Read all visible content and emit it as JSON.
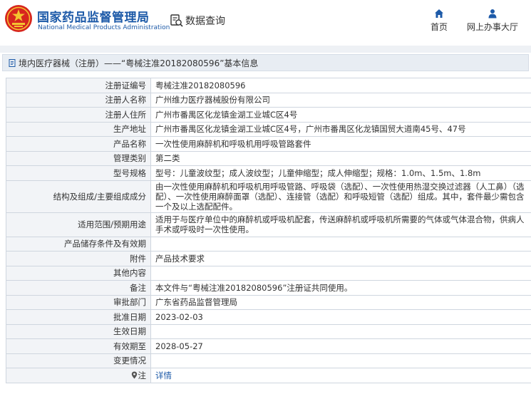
{
  "header": {
    "org_name_cn": "国家药品监督管理局",
    "org_name_en": "National Medical Products Administration",
    "query_label": "数据查询",
    "nav": [
      {
        "label": "首页",
        "icon": "home-icon"
      },
      {
        "label": "网上办事大厅",
        "icon": "user-icon"
      }
    ]
  },
  "title_bar": {
    "text": "境内医疗器械（注册）——“粤械注准20182080596”基本信息"
  },
  "rows": [
    {
      "label": "注册证编号",
      "value": "粤械注准20182080596"
    },
    {
      "label": "注册人名称",
      "value": "广州维力医疗器械股份有限公司"
    },
    {
      "label": "注册人住所",
      "value": "广州市番禺区化龙镇金湖工业城C区4号"
    },
    {
      "label": "生产地址",
      "value": "广州市番禺区化龙镇金湖工业城C区4号，广州市番禺区化龙镇国贸大道南45号、47号"
    },
    {
      "label": "产品名称",
      "value": "一次性使用麻醉机和呼吸机用呼吸管路套件"
    },
    {
      "label": "管理类别",
      "value": "第二类"
    },
    {
      "label": "型号规格",
      "value": "型号：儿童波纹型；成人波纹型；儿童伸缩型；成人伸缩型；规格：1.0m、1.5m、1.8m"
    },
    {
      "label": "结构及组成/主要组成成分",
      "value": "由一次性使用麻醉机和呼吸机用呼吸管路、呼吸袋（选配）、一次性使用热湿交换过滤器（人工鼻）（选配）、一次性使用麻醉面罩（选配）、连接管（选配）和呼吸短管（选配）组成。其中，套件最少需包含一个及以上选配配件。"
    },
    {
      "label": "适用范围/预期用途",
      "value": "适用于与医疗单位中的麻醉机或呼吸机配套，传送麻醉机或呼吸机所需要的气体或气体混合物，供病人手术或呼吸时一次性使用。"
    },
    {
      "label": "产品储存条件及有效期",
      "value": ""
    },
    {
      "label": "附件",
      "value": "产品技术要求"
    },
    {
      "label": "其他内容",
      "value": ""
    },
    {
      "label": "备注",
      "value": "本文件与“粤械注准20182080596”注册证共同使用。"
    },
    {
      "label": "审批部门",
      "value": "广东省药品监督管理局"
    },
    {
      "label": "批准日期",
      "value": "2023-02-03"
    },
    {
      "label": "生效日期",
      "value": ""
    },
    {
      "label": "有效期至",
      "value": "2028-05-27"
    },
    {
      "label": "变更情况",
      "value": ""
    },
    {
      "label": "注",
      "value": "详情"
    }
  ],
  "colors": {
    "brand_blue": "#1d5aa8",
    "logo_red": "#d7261e",
    "label_bg": "#f2f4f7",
    "title_bar_bg": "#e8edf3"
  }
}
